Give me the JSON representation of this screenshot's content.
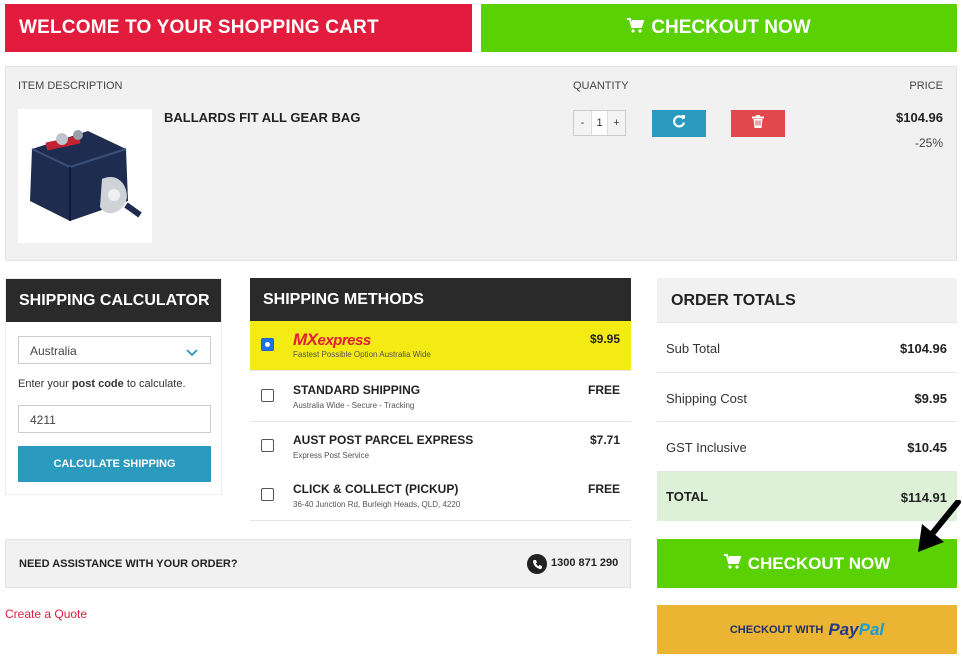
{
  "header": {
    "welcome": "WELCOME TO YOUR SHOPPING CART",
    "checkout_label": "CHECKOUT NOW"
  },
  "cart": {
    "columns": {
      "item": "ITEM DESCRIPTION",
      "quantity": "QUANTITY",
      "price": "PRICE"
    },
    "items": [
      {
        "name": "BALLARDS FIT ALL GEAR BAG",
        "quantity": "1",
        "price": "$104.96",
        "discount": "-25%"
      }
    ]
  },
  "calculator": {
    "title": "SHIPPING CALCULATOR",
    "country": "Australia",
    "hint_pre": "Enter your ",
    "hint_bold": "post code",
    "hint_post": " to calculate.",
    "postcode": "4211",
    "button": "CALCULATE SHIPPING"
  },
  "methods": {
    "title": "SHIPPING METHODS",
    "items": [
      {
        "name": "MXexpress",
        "logo_a": "MX",
        "logo_b": "express",
        "sub": "Fastest Possible Option Australia Wide",
        "price": "$9.95",
        "selected": true
      },
      {
        "name": "STANDARD SHIPPING",
        "sub": "Australia Wide - Secure - Tracking",
        "price": "FREE",
        "selected": false
      },
      {
        "name": "AUST POST PARCEL EXPRESS",
        "sub": "Express Post Service",
        "price": "$7.71",
        "selected": false
      },
      {
        "name": "CLICK & COLLECT (PICKUP)",
        "sub": "36-40 Junction Rd, Burleigh Heads, QLD, 4220",
        "price": "FREE",
        "selected": false
      }
    ]
  },
  "totals": {
    "title": "ORDER TOTALS",
    "rows": [
      {
        "label": "Sub Total",
        "value": "$104.96"
      },
      {
        "label": "Shipping Cost",
        "value": "$9.95"
      },
      {
        "label": "GST Inclusive",
        "value": "$10.45"
      },
      {
        "label": "TOTAL",
        "value": "$114.91"
      }
    ]
  },
  "assist": {
    "text": "NEED ASSISTANCE WITH YOUR ORDER?",
    "phone": "1300 871 290"
  },
  "links": {
    "quote": "Create a Quote"
  },
  "checkout": {
    "label": "CHECKOUT NOW",
    "paypal_prefix": "CHECKOUT WITH",
    "paypal_a": "Pay",
    "paypal_b": "Pal"
  },
  "colors": {
    "brand_red": "#e31b3c",
    "checkout_green": "#5ad102",
    "accent_blue": "#2b9abf",
    "mx_yellow": "#f4ea14",
    "paypal_gold": "#ebb533"
  }
}
